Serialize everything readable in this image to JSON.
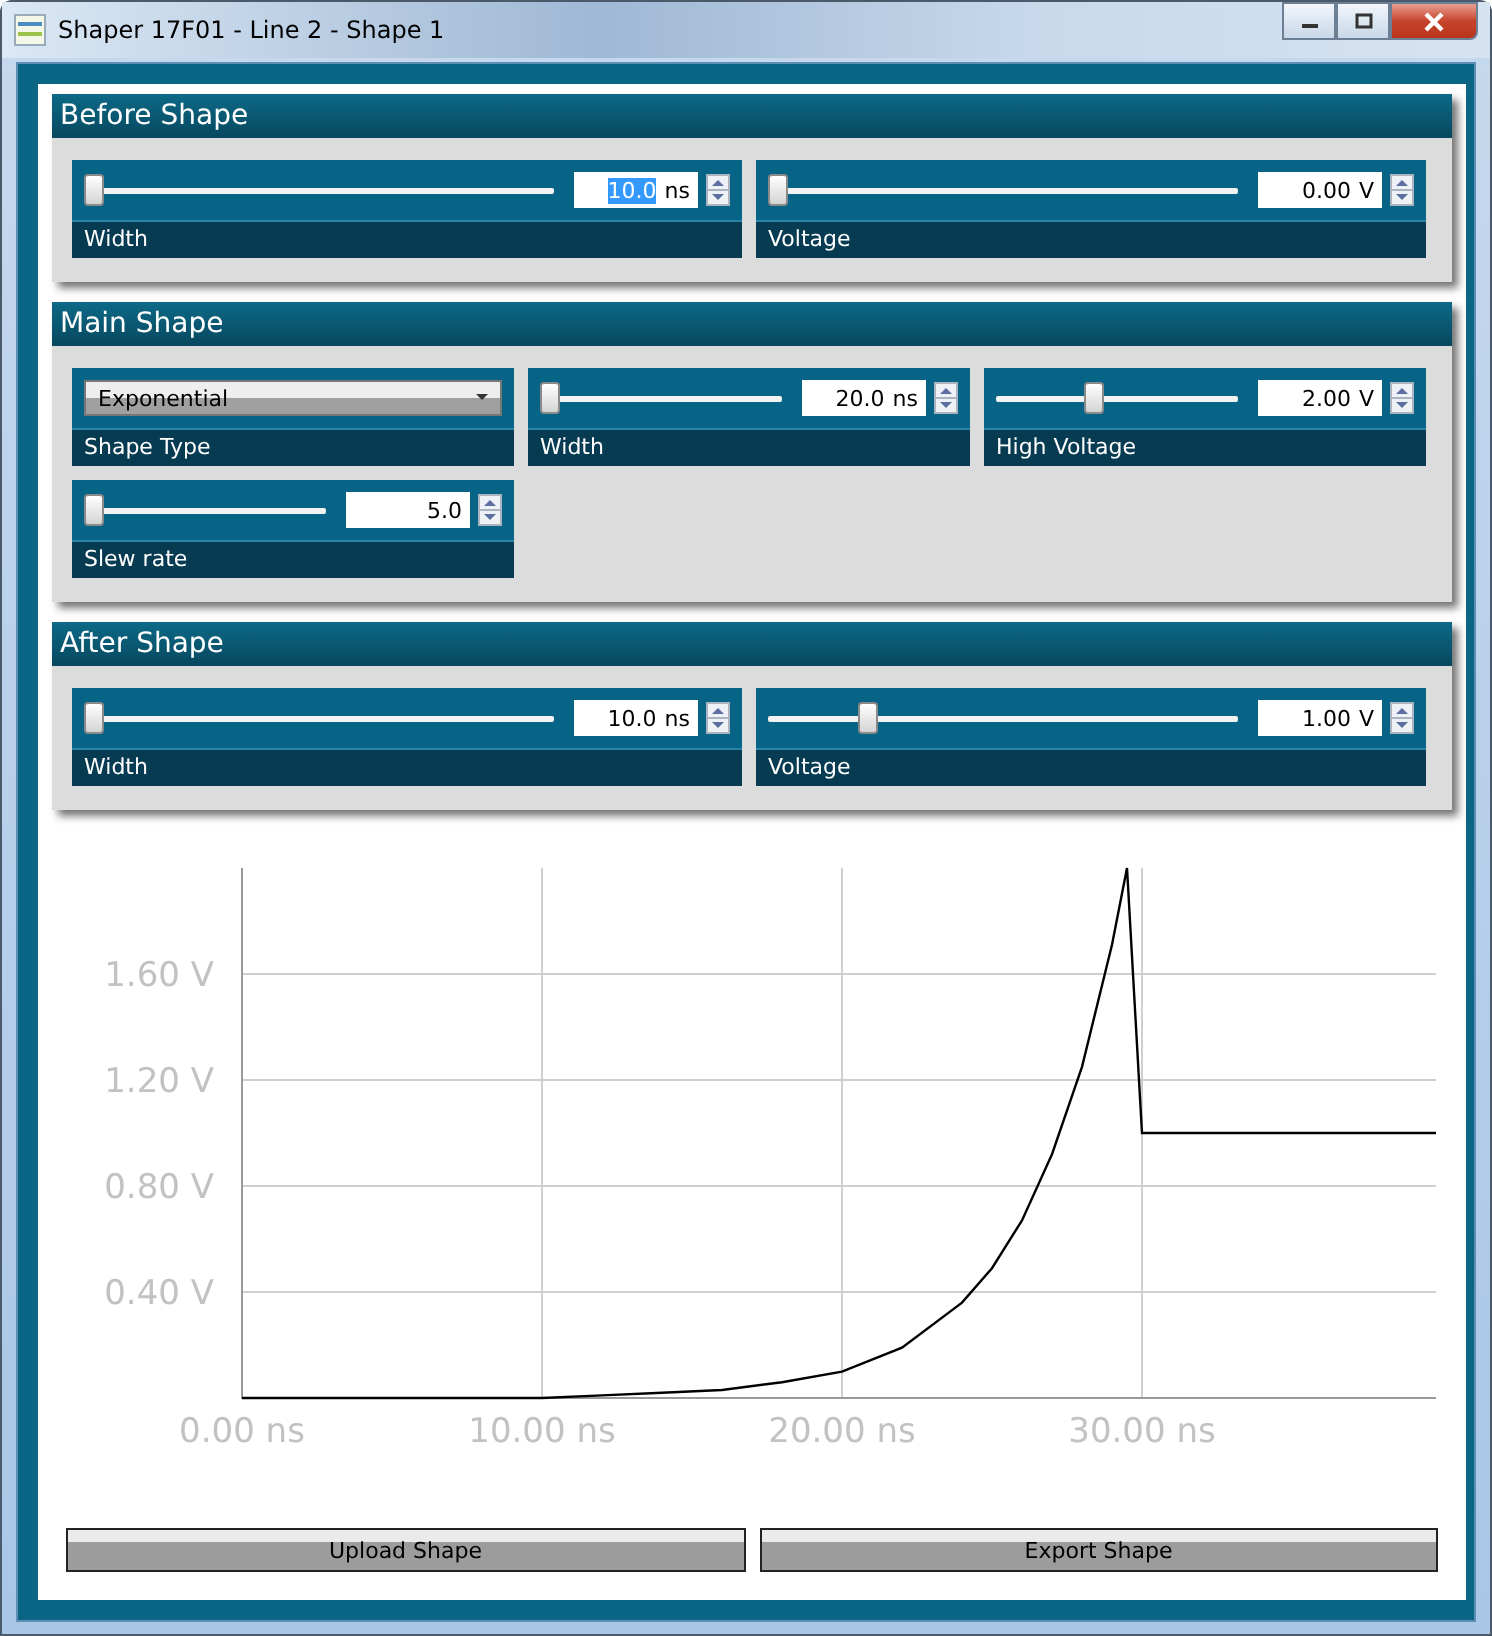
{
  "window": {
    "title": "Shaper 17F01 - Line 2 - Shape 1"
  },
  "sections": [
    {
      "title": "Before Shape",
      "controls": [
        {
          "kind": "slider",
          "caption": "Width",
          "level": 0,
          "value": "10.0",
          "unit": "ns",
          "selected": true
        },
        {
          "kind": "slider",
          "caption": "Voltage",
          "level": 0,
          "value": "0.00",
          "unit": "V",
          "selected": false
        }
      ]
    },
    {
      "title": "Main Shape",
      "controls": [
        {
          "kind": "dropdown",
          "caption": "Shape Type",
          "value": "Exponential"
        },
        {
          "kind": "slider",
          "caption": "Width",
          "level": 0,
          "value": "20.0",
          "unit": "ns",
          "selected": false
        },
        {
          "kind": "slider",
          "caption": "High Voltage",
          "level": 0.4,
          "value": "2.00",
          "unit": "V",
          "selected": false
        },
        {
          "kind": "slider",
          "caption": "Slew rate",
          "level": 0,
          "value": "5.0",
          "selected": false
        }
      ]
    },
    {
      "title": "After Shape",
      "controls": [
        {
          "kind": "slider",
          "caption": "Width",
          "level": 0,
          "value": "10.0",
          "unit": "ns",
          "selected": false
        },
        {
          "kind": "slider",
          "caption": "Voltage",
          "level": 0.2,
          "value": "1.00",
          "unit": "V",
          "selected": false
        }
      ]
    }
  ],
  "chart": {
    "chart_data": {
      "type": "line",
      "x": [
        0,
        10,
        12,
        14,
        16,
        18,
        20,
        22,
        24,
        25,
        26,
        27,
        28,
        29,
        29.5,
        30,
        39.8
      ],
      "grid": true,
      "series": [
        {
          "color": "#000000",
          "values": [
            0,
            0,
            0.01,
            0.02,
            0.03,
            0.06,
            0.1,
            0.19,
            0.36,
            0.49,
            0.67,
            0.92,
            1.25,
            1.71,
            2.0,
            1.0,
            1.0
          ]
        }
      ],
      "xlim": [
        0,
        39.8
      ],
      "ylim": [
        0,
        2.0
      ],
      "xticks": [
        {
          "value": 0,
          "label": "0.00 ns"
        },
        {
          "value": 10,
          "label": "10.00 ns"
        },
        {
          "value": 20,
          "label": "20.00 ns"
        },
        {
          "value": 30,
          "label": "30.00 ns"
        }
      ],
      "yticks": [
        {
          "value": 0.4,
          "label": "0.40 V"
        },
        {
          "value": 0.8,
          "label": "0.80 V"
        },
        {
          "value": 1.2,
          "label": "1.20 V"
        },
        {
          "value": 1.6,
          "label": "1.60 V"
        }
      ]
    }
  },
  "buttons": [
    "Upload Shape",
    "Export Shape"
  ]
}
